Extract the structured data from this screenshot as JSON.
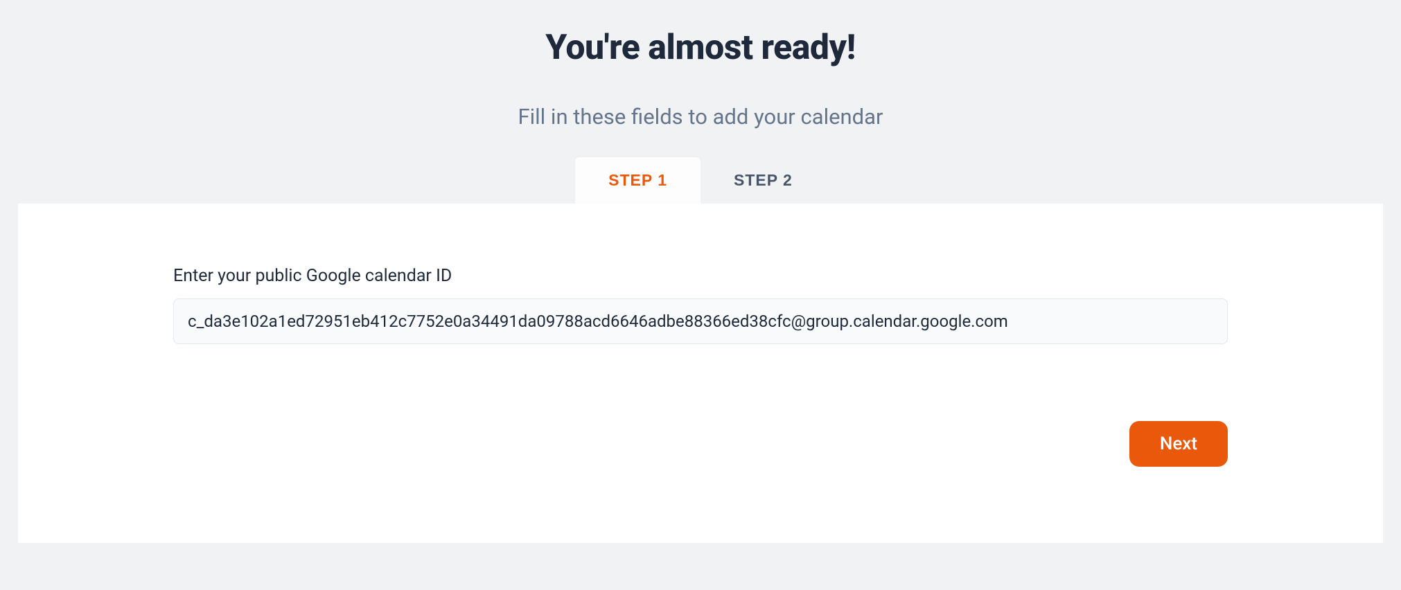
{
  "header": {
    "title": "You're almost ready!",
    "subtitle": "Fill in these fields to add your calendar"
  },
  "tabs": {
    "step1_label": "STEP 1",
    "step2_label": "STEP 2"
  },
  "form": {
    "calendar_id_label": "Enter your public Google calendar ID",
    "calendar_id_value": "c_da3e102a1ed72951eb412c7752e0a34491da09788acd6646adbe88366ed38cfc@group.calendar.google.com"
  },
  "buttons": {
    "next_label": "Next"
  },
  "colors": {
    "accent": "#ea580c",
    "text_dark": "#1e293b",
    "text_muted": "#64748b",
    "bg_page": "#f1f2f4",
    "bg_card": "#ffffff",
    "bg_input": "#f8fafc",
    "border_input": "#e2e8f0"
  }
}
